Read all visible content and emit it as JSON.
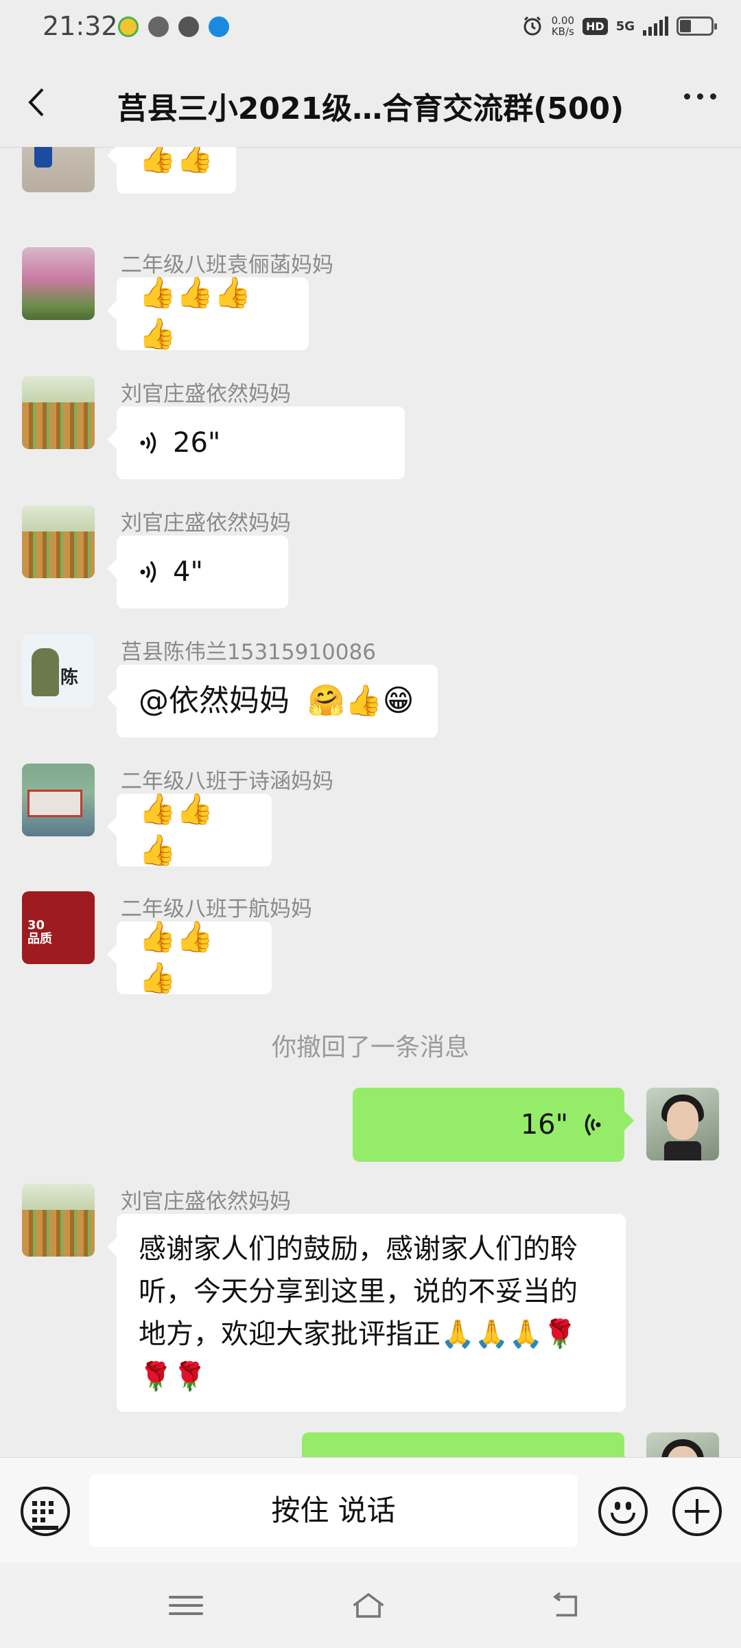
{
  "status_bar": {
    "time": "21:32",
    "net_speed": "0.00",
    "net_unit": "KB/s",
    "hd": "HD",
    "network": "5G",
    "icons": [
      "alarm-icon",
      "wifi-signal-icon",
      "battery-icon"
    ]
  },
  "header": {
    "title": "莒县三小2021级…合育交流群(500)",
    "back_icon": "chevron-left-icon",
    "more_icon": "more-icon"
  },
  "messages": [
    {
      "sender": "",
      "type": "emoji",
      "content": "👍👍"
    },
    {
      "sender": "二年级八班袁俪菡妈妈",
      "type": "emoji",
      "content": "👍👍👍👍"
    },
    {
      "sender": "刘官庄盛依然妈妈",
      "type": "voice",
      "duration": "26\""
    },
    {
      "sender": "刘官庄盛依然妈妈",
      "type": "voice",
      "duration": "4\""
    },
    {
      "sender": "莒县陈伟兰15315910086",
      "type": "text",
      "content": "@依然妈妈",
      "emoji": "🤗👍😁"
    },
    {
      "sender": "二年级八班于诗涵妈妈",
      "type": "emoji",
      "content": "👍👍👍"
    },
    {
      "sender": "二年级八班于航妈妈",
      "type": "emoji",
      "content": "👍👍👍"
    },
    {
      "type": "system",
      "content": "你撤回了一条消息"
    },
    {
      "sender": "me",
      "type": "voice",
      "duration": "16\""
    },
    {
      "sender": "刘官庄盛依然妈妈",
      "type": "text",
      "content": "感谢家人们的鼓励，感谢家人们的聆听，今天分享到这里，说的不妥当的地方，欢迎大家批评指正🙏🙏🙏🌹🌹🌹"
    }
  ],
  "input_bar": {
    "hold_to_talk": "按住 说话",
    "icons": [
      "keyboard-icon",
      "emoji-icon",
      "plus-icon"
    ]
  },
  "nav_bar": {
    "icons": [
      "menu-icon",
      "home-icon",
      "back-icon"
    ]
  },
  "colors": {
    "background": "#ededed",
    "my_bubble": "#95ec69",
    "their_bubble": "#ffffff",
    "sender_name": "#8a8a8a"
  }
}
